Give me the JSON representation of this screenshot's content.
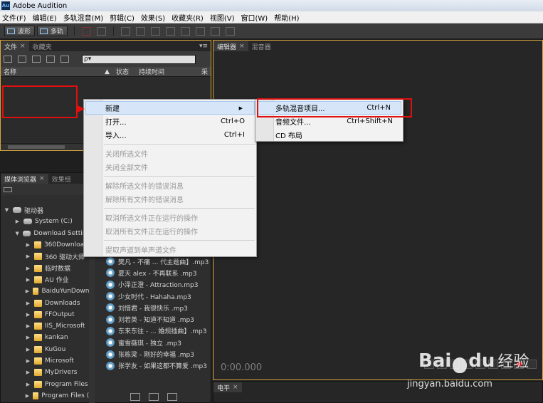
{
  "app": {
    "title": "Adobe Audition",
    "logo_text": "Au"
  },
  "menubar": [
    "文件(F)",
    "编辑(E)",
    "多轨混音(M)",
    "剪辑(C)",
    "效果(S)",
    "收藏夹(R)",
    "视图(V)",
    "窗口(W)",
    "帮助(H)"
  ],
  "toolbar": {
    "waveform_label": "波形",
    "multitrack_label": "多轨"
  },
  "files_panel": {
    "tabs": [
      "文件",
      "收藏夹"
    ],
    "search_placeholder": "ρ▾",
    "columns": [
      "名称",
      "状态",
      "持续时间",
      "采"
    ]
  },
  "media_panel": {
    "tabs": [
      "媒体浏览器",
      "效果组"
    ],
    "tree": [
      {
        "label": "驱动器",
        "type": "drive",
        "depth": 0,
        "expanded": true
      },
      {
        "label": "System (C:)",
        "type": "drive",
        "depth": 1,
        "expanded": false
      },
      {
        "label": "Download Settings",
        "type": "drive",
        "depth": 1,
        "expanded": true
      },
      {
        "label": "360Downloads",
        "type": "folder",
        "depth": 2
      },
      {
        "label": "360 驱动大师",
        "type": "folder",
        "depth": 2
      },
      {
        "label": "临时数据",
        "type": "folder",
        "depth": 2
      },
      {
        "label": "AU 作业",
        "type": "folder",
        "depth": 2
      },
      {
        "label": "BaiduYunDownload",
        "type": "folder",
        "depth": 2
      },
      {
        "label": "Downloads",
        "type": "folder",
        "depth": 2
      },
      {
        "label": "FFOutput",
        "type": "folder",
        "depth": 2
      },
      {
        "label": "IIS_Microsoft",
        "type": "folder",
        "depth": 2
      },
      {
        "label": "kankan",
        "type": "folder",
        "depth": 2
      },
      {
        "label": "KuGou",
        "type": "folder",
        "depth": 2
      },
      {
        "label": "Microsoft",
        "type": "folder",
        "depth": 2
      },
      {
        "label": "MyDrivers",
        "type": "folder",
        "depth": 2
      },
      {
        "label": "Program Files",
        "type": "folder",
        "depth": 2
      },
      {
        "label": "Program Files (x86)",
        "type": "folder",
        "depth": 2
      }
    ],
    "files": [
      "樊凡 - 不痛 ... 代主题曲】.mp3",
      "夏天 alex - 不再联系 .mp3",
      "小泽正澄 - Attraction.mp3",
      "少女时代 - Hahaha.mp3",
      "刘惜君 - 我很快乐 .mp3",
      "刘若英 - 知道不知道 .mp3",
      "东来东往 - ... 婚规插曲】.mp3",
      "蜜雪薇琪 - 独立 .mp3",
      "张栋梁 - 刚好的幸福 .mp3",
      "张学友 - 如果这都不算爱 .mp3"
    ]
  },
  "editor_panel": {
    "tabs": [
      "编辑器",
      "混音器"
    ],
    "timecode": "0:00.000"
  },
  "level_panel": {
    "tab": "电平"
  },
  "context_menu": {
    "items": [
      {
        "label": "新建",
        "shortcut": "",
        "submenu": true,
        "enabled": true,
        "highlight": true
      },
      {
        "label": "打开...",
        "shortcut": "Ctrl+O",
        "enabled": true
      },
      {
        "label": "导入...",
        "shortcut": "Ctrl+I",
        "enabled": true,
        "sep_after": true
      },
      {
        "label": "关闭所选文件",
        "shortcut": "",
        "enabled": false
      },
      {
        "label": "关闭全部文件",
        "shortcut": "",
        "enabled": false,
        "sep_after": true
      },
      {
        "label": "解除所选文件的错误消息",
        "shortcut": "",
        "enabled": false
      },
      {
        "label": "解除所有文件的错误消息",
        "shortcut": "",
        "enabled": false,
        "sep_after": true
      },
      {
        "label": "取消所选文件正在运行的操作",
        "shortcut": "",
        "enabled": false
      },
      {
        "label": "取消所有文件正在运行的操作",
        "shortcut": "",
        "enabled": false,
        "sep_after": true
      },
      {
        "label": "提取声道到单声道文件",
        "shortcut": "",
        "enabled": false
      }
    ]
  },
  "submenu": {
    "items": [
      {
        "label": "多轨混音项目...",
        "shortcut": "Ctrl+N",
        "highlight": true
      },
      {
        "label": "音频文件...",
        "shortcut": "Ctrl+Shift+N"
      },
      {
        "label": "CD 布局",
        "shortcut": ""
      }
    ]
  },
  "watermark": {
    "brand": "Bai",
    "brand_tail": "du",
    "brand_cn": "经验",
    "url": "jingyan.baidu.com"
  },
  "colors": {
    "annotation": "#e01010",
    "panel_focus": "#d7a640",
    "menu_highlight": "#d6e6f8"
  }
}
